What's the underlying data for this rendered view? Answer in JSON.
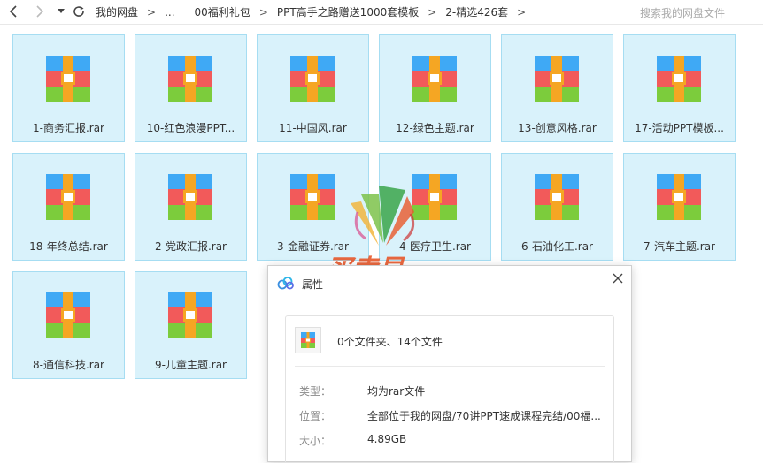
{
  "toolbar": {
    "back_icon": "chevron-left-icon",
    "forward_icon": "chevron-right-icon",
    "history_icon": "dropdown-caret-icon",
    "refresh_icon": "refresh-icon",
    "breadcrumb": [
      "我的网盘",
      "...",
      "00福利礼包",
      "PPT高手之路赠送1000套模板",
      "2-精选426套"
    ],
    "search_placeholder": "搜索我的网盘文件"
  },
  "files": [
    {
      "name": "1-商务汇报.rar"
    },
    {
      "name": "10-红色浪漫PPT..."
    },
    {
      "name": "11-中国风.rar"
    },
    {
      "name": "12-绿色主题.rar"
    },
    {
      "name": "13-创意风格.rar"
    },
    {
      "name": "17-活动PPT模板..."
    },
    {
      "name": "18-年终总结.rar"
    },
    {
      "name": "2-党政汇报.rar"
    },
    {
      "name": "3-金融证券.rar"
    },
    {
      "name": "4-医疗卫生.rar"
    },
    {
      "name": "6-石油化工.rar"
    },
    {
      "name": "7-汽车主题.rar"
    },
    {
      "name": "8-通信科技.rar"
    },
    {
      "name": "9-儿童主题.rar"
    }
  ],
  "watermark": {
    "text": "买卖易"
  },
  "dialog": {
    "title": "属性",
    "summary": "0个文件夹、14个文件",
    "rows": [
      {
        "label": "类型：",
        "value": "均为rar文件"
      },
      {
        "label": "位置：",
        "value": "全部位于我的网盘/70讲PPT速成课程完结/00福..."
      },
      {
        "label": "大小：",
        "value": "4.89GB"
      }
    ]
  },
  "colors": {
    "tile_bg": "#d9f2fb",
    "tile_border": "#a6ddf2",
    "rar_blue": "#3fa9f5",
    "rar_red": "#f25a5a",
    "rar_green": "#7ccc3c",
    "rar_band": "#f5a623"
  }
}
